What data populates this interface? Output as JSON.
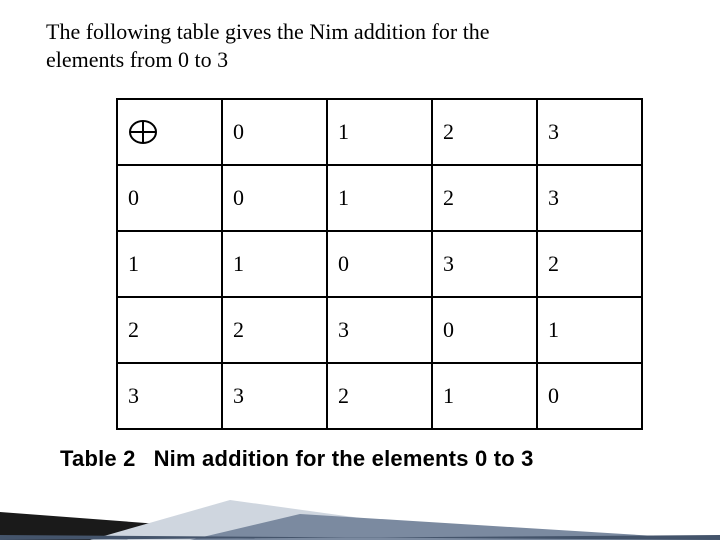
{
  "intro_text": "The following table gives the Nim addition for the elements from 0 to 3",
  "symbol_name": "oplus-icon",
  "chart_data": {
    "type": "table",
    "title": "Nim addition for the elements 0 to 3",
    "row_headers": [
      "0",
      "1",
      "2",
      "3"
    ],
    "col_headers": [
      "0",
      "1",
      "2",
      "3"
    ],
    "rows": [
      [
        "0",
        "1",
        "2",
        "3"
      ],
      [
        "1",
        "0",
        "3",
        "2"
      ],
      [
        "2",
        "3",
        "0",
        "1"
      ],
      [
        "3",
        "2",
        "1",
        "0"
      ]
    ]
  },
  "caption_label": "Table 2",
  "caption_text": "Nim addition for the elements 0 to 3"
}
